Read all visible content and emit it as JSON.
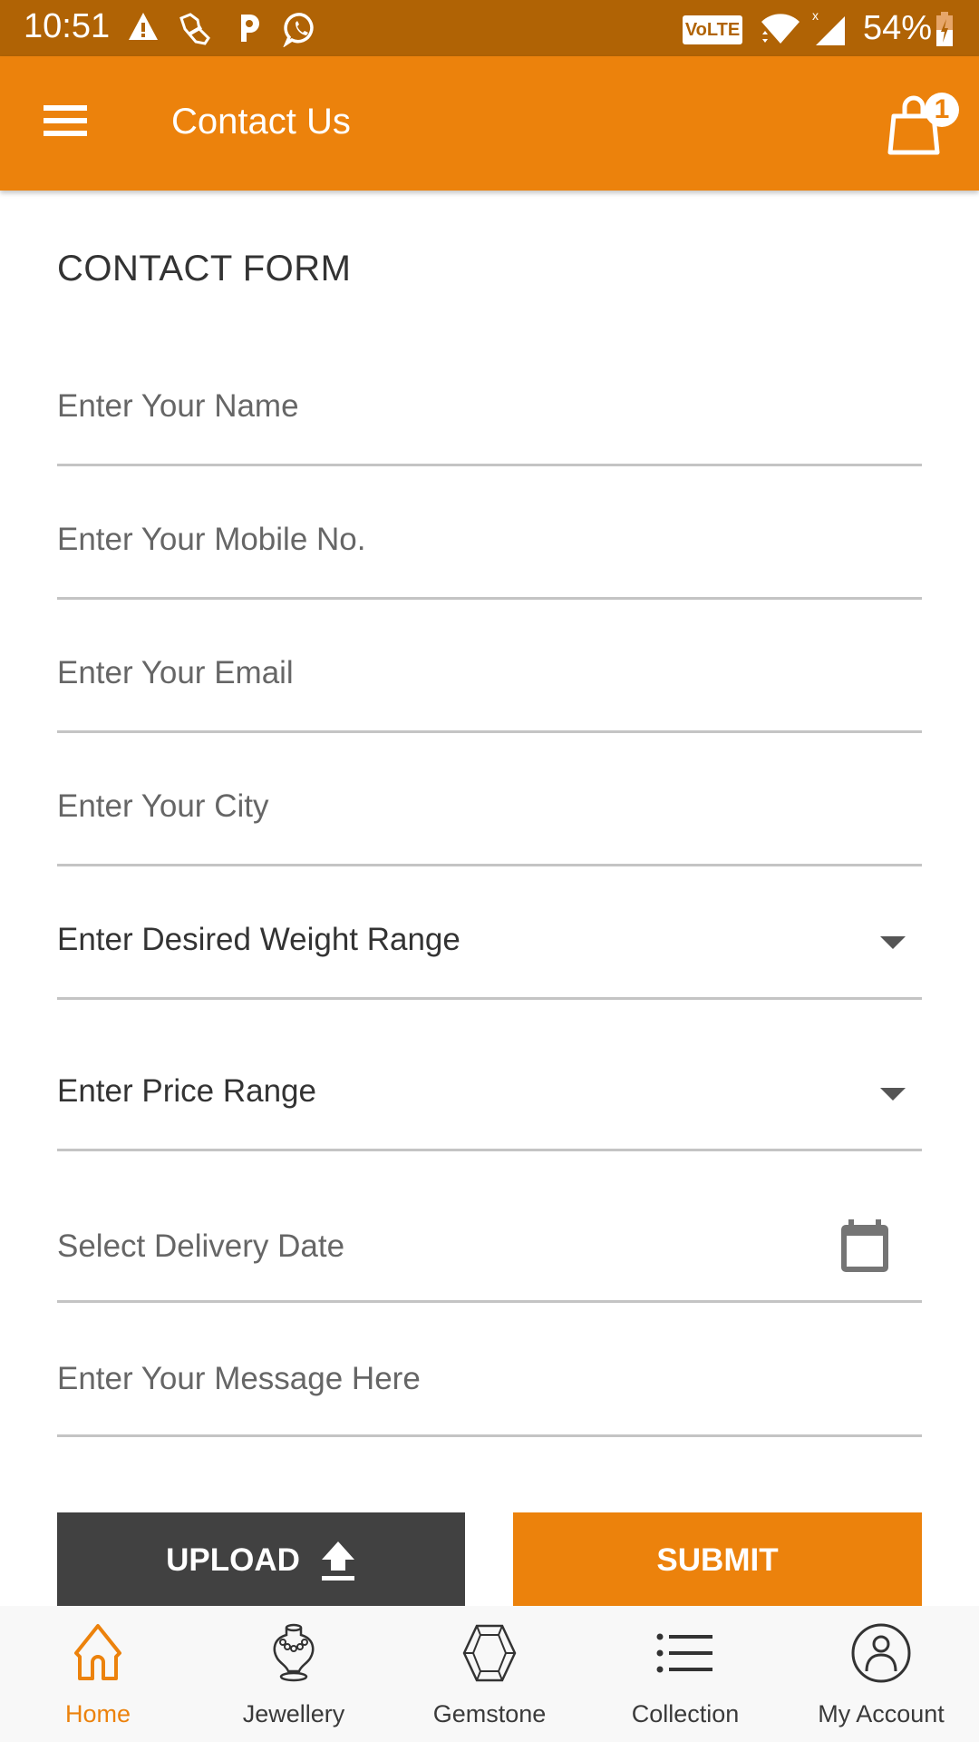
{
  "status_bar": {
    "time": "10:51",
    "notification_icons": [
      "warning-icon",
      "shoe-icon",
      "paytm-p-icon",
      "whatsapp-icon"
    ],
    "volte_label": "VoLTE",
    "battery_percent": "54%",
    "battery_charging": true
  },
  "app_bar": {
    "title": "Contact Us",
    "menu_icon": "hamburger-menu-icon",
    "cart_icon": "shopping-bag-icon",
    "cart_count": "1"
  },
  "form": {
    "title": "CONTACT FORM",
    "fields": [
      {
        "type": "text",
        "placeholder": "Enter Your Name",
        "value": ""
      },
      {
        "type": "text",
        "placeholder": "Enter Your Mobile No.",
        "value": ""
      },
      {
        "type": "text",
        "placeholder": "Enter Your Email",
        "value": ""
      },
      {
        "type": "text",
        "placeholder": "Enter Your City",
        "value": ""
      },
      {
        "type": "dropdown",
        "selected": "Enter Desired Weight Range"
      },
      {
        "type": "dropdown",
        "selected": "Enter Price Range"
      },
      {
        "type": "date",
        "placeholder": "Select Delivery Date",
        "value": "",
        "icon": "calendar-icon"
      },
      {
        "type": "text",
        "placeholder": "Enter Your Message Here",
        "value": ""
      }
    ],
    "upload_label": "UPLOAD",
    "upload_icon": "upload-arrow-icon",
    "submit_label": "SUBMIT"
  },
  "bottom_nav": {
    "items": [
      {
        "label": "Home",
        "icon": "home-icon",
        "active": true
      },
      {
        "label": "Jewellery",
        "icon": "necklace-bust-icon",
        "active": false
      },
      {
        "label": "Gemstone",
        "icon": "gemstone-icon",
        "active": false
      },
      {
        "label": "Collection",
        "icon": "list-icon",
        "active": false
      },
      {
        "label": "My Account",
        "icon": "account-icon",
        "active": false
      }
    ]
  },
  "colors": {
    "primary": "#ec820c",
    "status_bar": "#b06305",
    "upload_button": "#414141",
    "active_nav": "#ec820c"
  }
}
